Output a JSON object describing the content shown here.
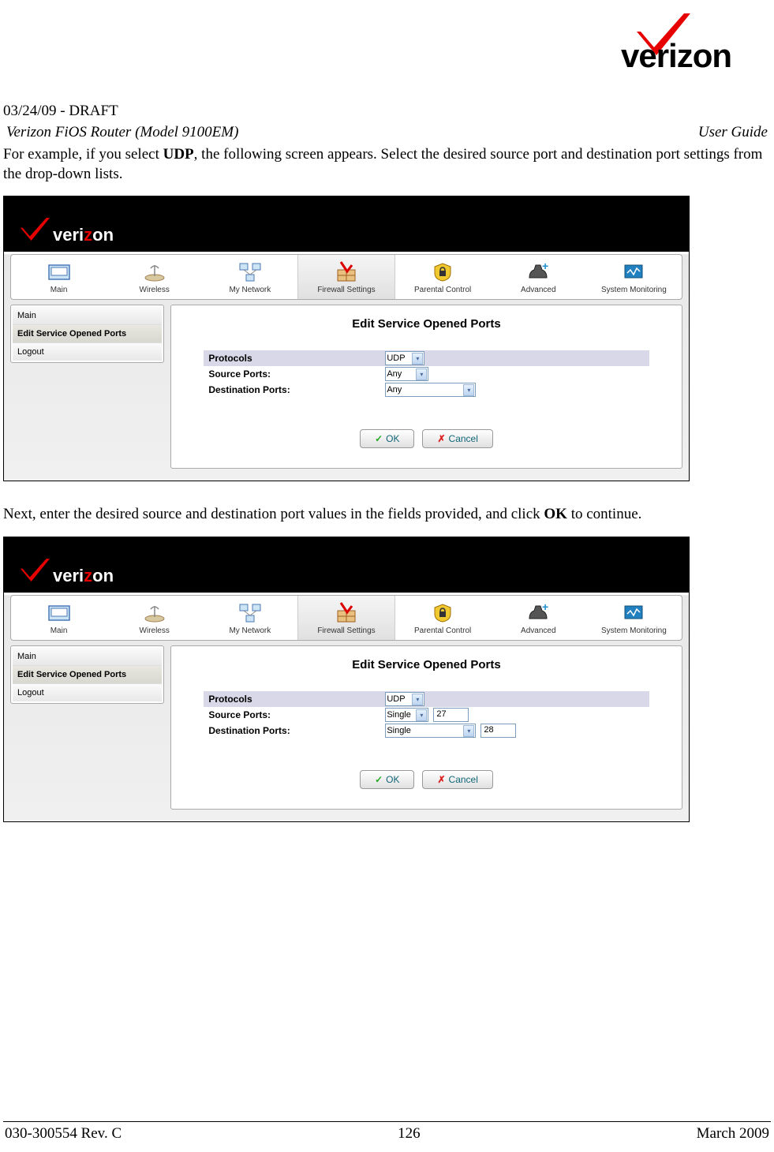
{
  "logo": {
    "brand": "verizon"
  },
  "draft": "03/24/09 - DRAFT",
  "header": {
    "left": "Verizon FiOS Router (Model 9100EM)",
    "right": "User Guide"
  },
  "para1_pre": "For example, if you select ",
  "para1_bold": "UDP",
  "para1_post": ", the following screen appears. Select the desired source port and destination port settings from the drop-down lists.",
  "para2_pre": "Next, enter the desired source and destination port values in the fields provided, and click ",
  "para2_bold": "OK",
  "para2_post": " to continue.",
  "nav": {
    "items": [
      "Main",
      "Wireless",
      "My Network",
      "Firewall Settings",
      "Parental Control",
      "Advanced",
      "System Monitoring"
    ],
    "active": "Firewall Settings"
  },
  "sidebar": {
    "items": [
      "Main",
      "Edit Service Opened Ports",
      "Logout"
    ],
    "active": "Edit Service Opened Ports"
  },
  "content": {
    "title": "Edit Service Opened Ports",
    "labels": {
      "protocols": "Protocols",
      "src": "Source Ports:",
      "dst": "Destination Ports:"
    }
  },
  "screen1": {
    "protocol": "UDP",
    "src": "Any",
    "dst": "Any"
  },
  "screen2": {
    "protocol": "UDP",
    "src_mode": "Single",
    "src_val": "27",
    "dst_mode": "Single",
    "dst_val": "28"
  },
  "buttons": {
    "ok": "OK",
    "cancel": "Cancel"
  },
  "footer": {
    "left": "030-300554 Rev. C",
    "center": "126",
    "right": "March 2009"
  }
}
